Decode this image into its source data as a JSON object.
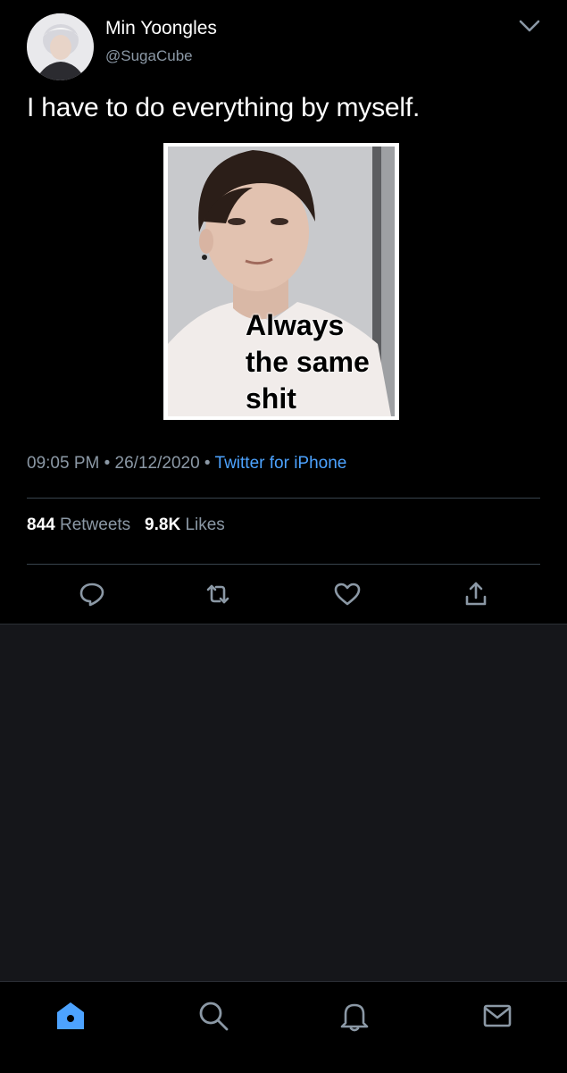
{
  "tweet": {
    "author_name": "Min Yoongles",
    "author_handle": "@SugaCube",
    "text": "I have to do everything by myself.",
    "image_caption": "Always\nthe same\nshit",
    "time": "09:05 PM",
    "date": "26/12/2020",
    "source": "Twitter for iPhone",
    "retweets_count": "844",
    "retweets_label": "Retweets",
    "likes_count": "9.8K",
    "likes_label": "Likes"
  },
  "icons": {
    "more": "chevron-down-icon",
    "reply": "reply-icon",
    "retweet": "retweet-icon",
    "like": "heart-icon",
    "share": "share-icon"
  },
  "tabbar": {
    "items": [
      "home-icon",
      "search-icon",
      "notifications-icon",
      "messages-icon"
    ],
    "active": "home-icon"
  },
  "colors": {
    "background": "#000000",
    "secondary_text": "#8b98a5",
    "accent": "#4da3ff",
    "divider": "#38444d"
  }
}
